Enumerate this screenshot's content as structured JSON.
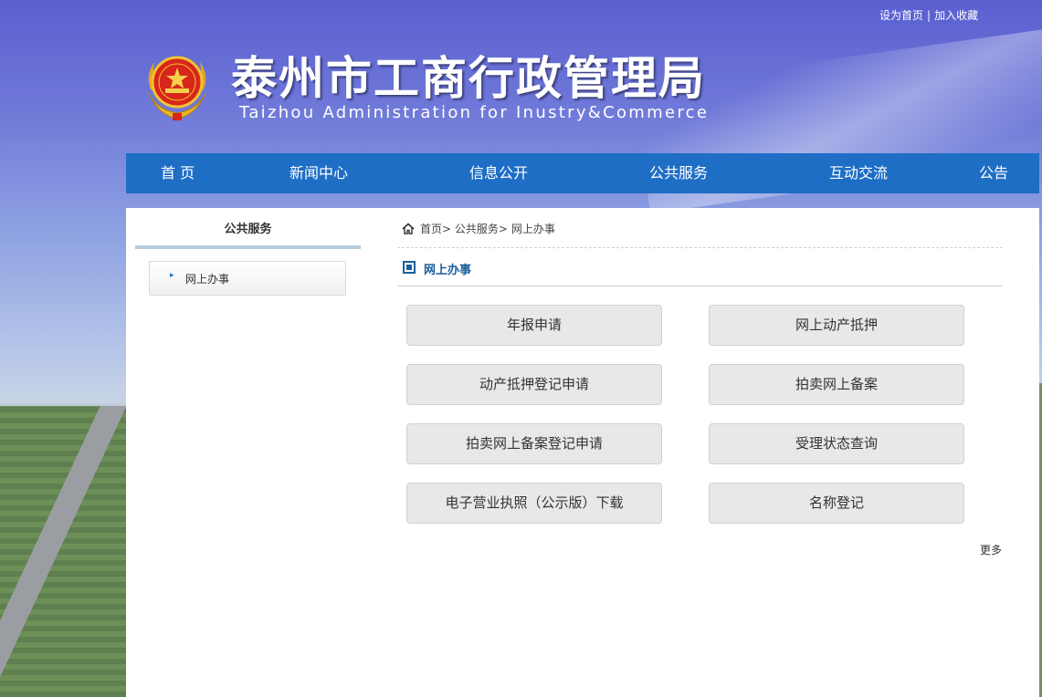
{
  "header": {
    "top_links": {
      "set_home": "设为首页",
      "separator": "|",
      "add_favorite": "加入收藏"
    },
    "title": "泰州市工商行政管理局",
    "subtitle": "Taizhou Administration for Inustry&Commerce",
    "emblem_icon": "national-emblem-icon"
  },
  "nav": {
    "items": [
      {
        "label": "首 页"
      },
      {
        "label": "新闻中心"
      },
      {
        "label": "信息公开"
      },
      {
        "label": "公共服务"
      },
      {
        "label": "互动交流"
      },
      {
        "label": "公告"
      }
    ]
  },
  "sidebar": {
    "title": "公共服务",
    "items": [
      {
        "label": "网上办事",
        "icon": "chevron-right-icon"
      }
    ]
  },
  "breadcrumb": {
    "icon": "home-icon",
    "items": [
      "首页",
      "公共服务",
      "网上办事"
    ],
    "separator": ">"
  },
  "section": {
    "title": "网上办事",
    "icon": "square-icon"
  },
  "services": [
    {
      "label": "年报申请"
    },
    {
      "label": "网上动产抵押"
    },
    {
      "label": "动产抵押登记申请"
    },
    {
      "label": "拍卖网上备案"
    },
    {
      "label": "拍卖网上备案登记申请"
    },
    {
      "label": "受理状态查询"
    },
    {
      "label": "电子营业执照（公示版）下载"
    },
    {
      "label": "名称登记"
    }
  ],
  "more_label": "更多",
  "colors": {
    "nav_bg": "#1e6ec5",
    "section_title": "#1c5e9a",
    "button_bg": "#e8e8e8"
  }
}
